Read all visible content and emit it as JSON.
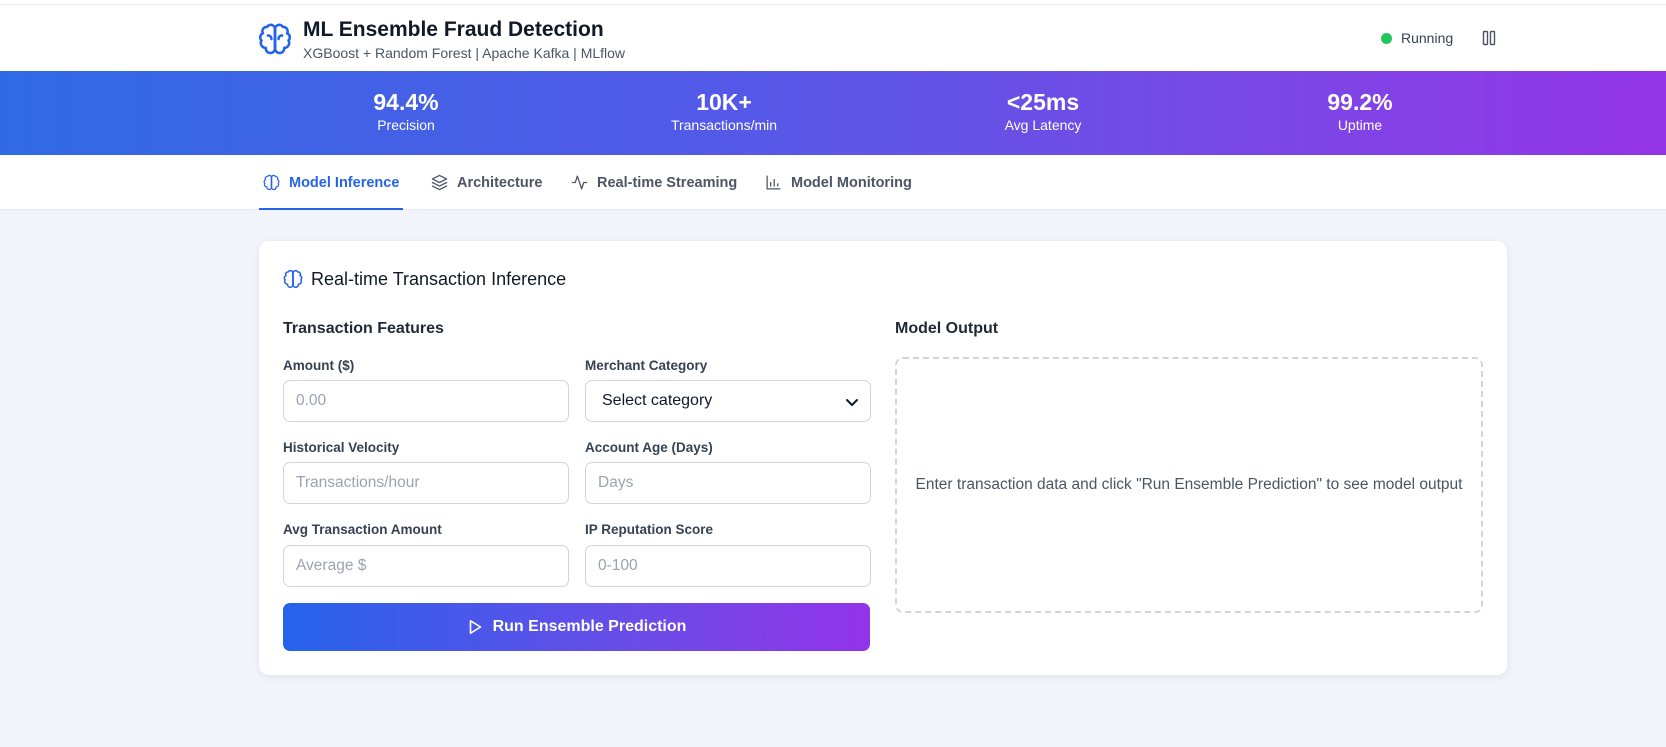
{
  "header": {
    "title": "ML Ensemble Fraud Detection",
    "subtitle": "XGBoost + Random Forest | Apache Kafka | MLflow",
    "status_label": "Running",
    "status_color": "#22c55e",
    "brand_icon": "brain-icon",
    "pause_icon": "pause-icon"
  },
  "stats": [
    {
      "value": "94.4%",
      "label": "Precision"
    },
    {
      "value": "10K+",
      "label": "Transactions/min"
    },
    {
      "value": "<25ms",
      "label": "Avg Latency"
    },
    {
      "value": "99.2%",
      "label": "Uptime"
    }
  ],
  "tabs": [
    {
      "label": "Model Inference",
      "icon": "brain-icon",
      "active": true
    },
    {
      "label": "Architecture",
      "icon": "layers-icon",
      "active": false
    },
    {
      "label": "Real-time Streaming",
      "icon": "activity-icon",
      "active": false
    },
    {
      "label": "Model Monitoring",
      "icon": "bar-chart-icon",
      "active": false
    }
  ],
  "card": {
    "title": "Real-time Transaction Inference",
    "features_title": "Transaction Features",
    "output_title": "Model Output",
    "output_placeholder": "Enter transaction data and click \"Run Ensemble Prediction\" to see model output",
    "run_button": "Run Ensemble Prediction"
  },
  "fields": {
    "amount": {
      "label": "Amount ($)",
      "placeholder": "0.00",
      "value": ""
    },
    "merchant_category": {
      "label": "Merchant Category",
      "selected": "Select category"
    },
    "historical_velocity": {
      "label": "Historical Velocity",
      "placeholder": "Transactions/hour",
      "value": ""
    },
    "account_age": {
      "label": "Account Age (Days)",
      "placeholder": "Days",
      "value": ""
    },
    "avg_amount": {
      "label": "Avg Transaction Amount",
      "placeholder": "Average $",
      "value": ""
    },
    "ip_score": {
      "label": "IP Reputation Score",
      "placeholder": "0-100",
      "value": ""
    }
  },
  "colors": {
    "accent": "#2563eb",
    "gradient_start": "#2f6ae6",
    "gradient_end": "#9334e8",
    "background": "#f1f5fb"
  }
}
